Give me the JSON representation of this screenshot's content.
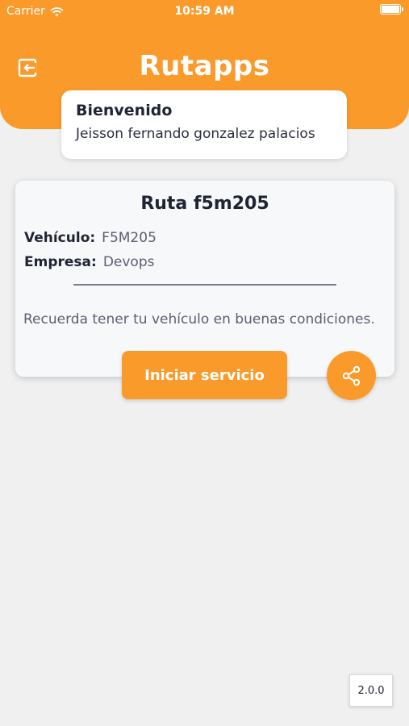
{
  "status_bar": {
    "carrier": "Carrier",
    "time": "10:59 AM",
    "battery_level": 1.0
  },
  "header": {
    "logo_text": "Rutapps",
    "logout_icon": "logout-icon",
    "background_color": "#fa9a2a"
  },
  "welcome": {
    "title": "Bienvenido",
    "user_name": "Jeisson fernando gonzalez palacios"
  },
  "route": {
    "title": "Ruta f5m205",
    "vehicle_label": "Vehículo:",
    "vehicle_value": "F5M205",
    "company_label": "Empresa:",
    "company_value": "Devops",
    "reminder": "Recuerda tener tu vehículo en buenas condiciones."
  },
  "actions": {
    "start_label": "Iniciar servicio",
    "share_icon": "share-icon"
  },
  "footer": {
    "version": "2.0.0"
  }
}
